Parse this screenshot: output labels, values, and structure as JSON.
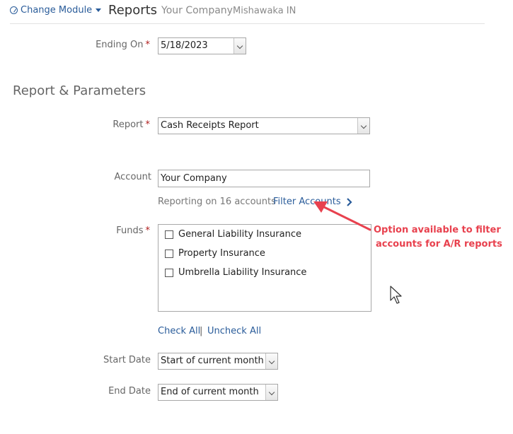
{
  "header": {
    "change_module": "Change Module",
    "title": "Reports",
    "company": "Your Company",
    "location": "Mishawaka IN"
  },
  "ending_on": {
    "label": "Ending On",
    "value": "5/18/2023"
  },
  "section_title": "Report & Parameters",
  "report": {
    "label": "Report",
    "value": "Cash Receipts Report"
  },
  "account": {
    "label": "Account",
    "value": "Your Company",
    "reporting_text": "Reporting on 16 accounts",
    "filter_link": "Filter Accounts"
  },
  "funds": {
    "label": "Funds",
    "items": [
      {
        "label": "General Liability Insurance",
        "checked": false
      },
      {
        "label": "Property Insurance",
        "checked": false
      },
      {
        "label": "Umbrella Liability Insurance",
        "checked": false
      }
    ],
    "check_all": "Check All",
    "separator": "|",
    "uncheck_all": "Uncheck All"
  },
  "start_date": {
    "label": "Start Date",
    "value": "Start of current month"
  },
  "end_date": {
    "label": "End Date",
    "value": "End of current month"
  },
  "annotation": {
    "line1": "Option available to filter",
    "line2": "accounts for A/R reports",
    "color": "#e8414e"
  },
  "colors": {
    "link": "#2a5c9a",
    "required": "#b01c1c"
  },
  "icons": {
    "change_module": "gear-icon",
    "dropdown": "chevron-down-icon",
    "filter": "chevron-right-icon"
  }
}
